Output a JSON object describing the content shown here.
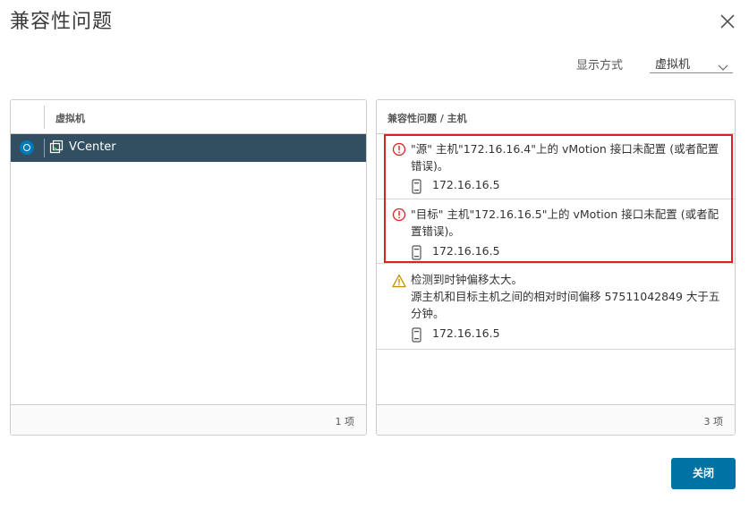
{
  "dialog": {
    "title": "兼容性问题",
    "close_icon": "close-icon"
  },
  "view": {
    "label": "显示方式",
    "selected": "虚拟机"
  },
  "vm_panel": {
    "column_header": "虚拟机",
    "rows": [
      {
        "name": "VCenter",
        "selected": true
      }
    ],
    "footer_count": "1 项"
  },
  "issues_panel": {
    "column_header": "兼容性问题 / 主机",
    "issues": [
      {
        "severity": "error",
        "message": "\"源\" 主机\"172.16.16.4\"上的 vMotion 接口未配置 (或者配置错误)。",
        "host": "172.16.16.5"
      },
      {
        "severity": "error",
        "message": "\"目标\" 主机\"172.16.16.5\"上的 vMotion 接口未配置 (或者配置错误)。",
        "host": "172.16.16.5"
      },
      {
        "severity": "warning",
        "message": "检测到时钟偏移太大。",
        "detail": "源主机和目标主机之间的相对时间偏移 57511042849 大于五分钟。",
        "host": "172.16.16.5"
      }
    ],
    "footer_count": "3 项"
  },
  "buttons": {
    "close_label": "关闭"
  },
  "colors": {
    "accent": "#0072a3",
    "selected_row": "#324f61",
    "error": "#e02020",
    "warning": "#c28b00"
  }
}
